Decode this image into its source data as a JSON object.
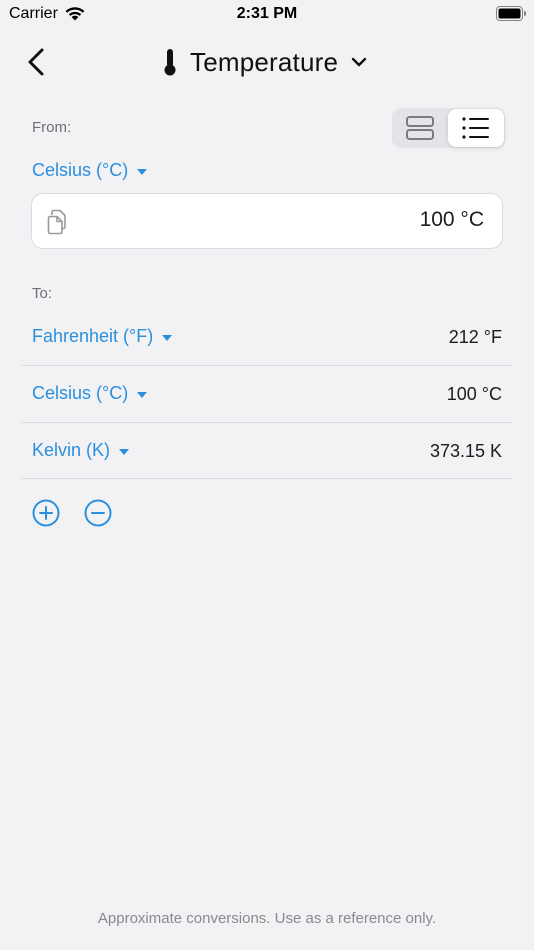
{
  "status_bar": {
    "carrier": "Carrier",
    "time": "2:31 PM"
  },
  "nav": {
    "title": "Temperature",
    "icons": [
      "back-chevron-icon",
      "thermometer-icon",
      "chevron-down-icon"
    ]
  },
  "view_toggle": {
    "options": [
      "cards-view-icon",
      "list-view-icon"
    ],
    "selected": "list-view-icon"
  },
  "from": {
    "label": "From:",
    "unit": "Celsius (°C)",
    "value": "100 °C"
  },
  "to": {
    "label": "To:",
    "rows": [
      {
        "unit": "Fahrenheit (°F)",
        "value": "212 °F"
      },
      {
        "unit": "Celsius (°C)",
        "value": "100 °C"
      },
      {
        "unit": "Kelvin (K)",
        "value": "373.15 K"
      }
    ]
  },
  "actions": {
    "add_icon": "plus-circle-icon",
    "remove_icon": "minus-circle-icon"
  },
  "footer": {
    "note": "Approximate conversions. Use as a reference only."
  },
  "colors": {
    "accent": "#2b8fdd",
    "background": "#f2f2f5"
  }
}
